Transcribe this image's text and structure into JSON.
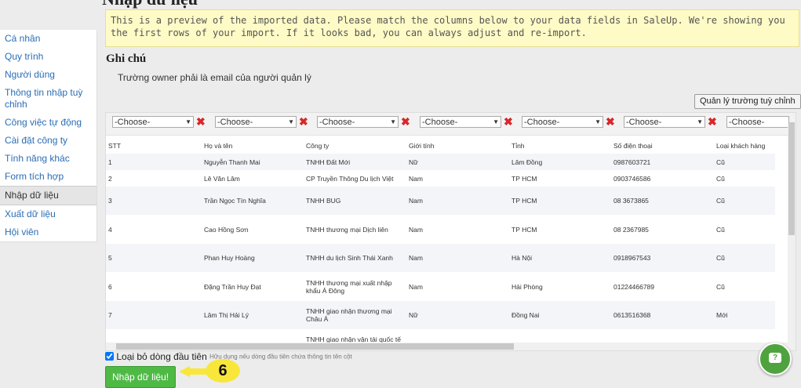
{
  "page": {
    "title_partial": "Nhập dữ liệu"
  },
  "notice": "This is a preview of the imported data. Please match the columns below to your data fields in SaleUp. We're showing you the first rows of your import. If it looks bad, you can always adjust and re-import.",
  "sidebar": {
    "items": [
      {
        "label": "Cá nhân",
        "active": false
      },
      {
        "label": "Quy trình",
        "active": false
      },
      {
        "label": "Người dùng",
        "active": false
      },
      {
        "label": "Thông tin nhập tuỳ chỉnh",
        "active": false
      },
      {
        "label": "Công việc tự động",
        "active": false
      },
      {
        "label": "Cài đặt công ty",
        "active": false
      },
      {
        "label": "Tính năng khác",
        "active": false
      },
      {
        "label": "Form tích hợp",
        "active": false
      },
      {
        "label": "Nhập dữ liệu",
        "active": true
      },
      {
        "label": "Xuất dữ liệu",
        "active": false
      },
      {
        "label": "Hội viên",
        "active": false
      }
    ]
  },
  "note": {
    "title": "Ghi chú",
    "text": "Trường owner phải là email của người quản lý"
  },
  "custom_fields_button": "Quản lý trường tuỳ chỉnh",
  "mapping": {
    "placeholder": "-Choose-",
    "count": 7
  },
  "table": {
    "headers": [
      "STT",
      "Họ và tên",
      "Công ty",
      "Giới tính",
      "Tỉnh",
      "Số điện thoại",
      "Loại khách hàng"
    ],
    "rows": [
      [
        "1",
        "Nguyễn Thanh Mai",
        "TNHH Đất Mới",
        "Nữ",
        "Lâm Đồng",
        "0987603721",
        "Cũ"
      ],
      [
        "2",
        "Lê Văn Lâm",
        "CP Truyền Thông Du lịch Việt",
        "Nam",
        "TP HCM",
        "0903746586",
        "Cũ"
      ],
      [
        "3",
        "Trần Ngọc Tín Nghĩa",
        "TNHH BUG",
        "Nam",
        "TP HCM",
        "08 3673865",
        "Cũ"
      ],
      [
        "4",
        "Cao Hồng Sơn",
        "TNHH thương mại Dịch liên",
        "Nam",
        "TP HCM",
        "08 2367985",
        "Cũ"
      ],
      [
        "5",
        "Phan Huy Hoàng",
        "TNHH du lịch Sinh Thái Xanh",
        "Nam",
        "Hà Nội",
        "0918967543",
        "Cũ"
      ],
      [
        "6",
        "Đặng Trần Huy Đạt",
        "TNHH thương mại xuất nhập khẩu Á Đông",
        "Nam",
        "Hải Phòng",
        "01224466789",
        "Cũ"
      ],
      [
        "7",
        "Lâm Thị Hải Lý",
        "TNHH giao nhận thương mại Châu Á",
        "Nữ",
        "Đồng Nai",
        "0613516368",
        "Mới"
      ],
      [
        "",
        "",
        "TNHH giao nhận vận tải quốc tế",
        "",
        "",
        "",
        ""
      ]
    ]
  },
  "skip_first_row": {
    "label": "Loại bỏ dòng đầu tiên",
    "hint": "Hữu dụng nếu dòng đầu tiên chứa thông tin tên cột",
    "checked": true
  },
  "import_button": "Nhập dữ liệu!",
  "callout_number": "6",
  "colors": {
    "accent_green": "#4fb946",
    "notice_bg": "#fefbc6",
    "link_blue": "#2a6db5",
    "callout_yellow": "#f8e73a"
  },
  "icons": {
    "remove": "x-icon",
    "chat": "chat-icon"
  }
}
